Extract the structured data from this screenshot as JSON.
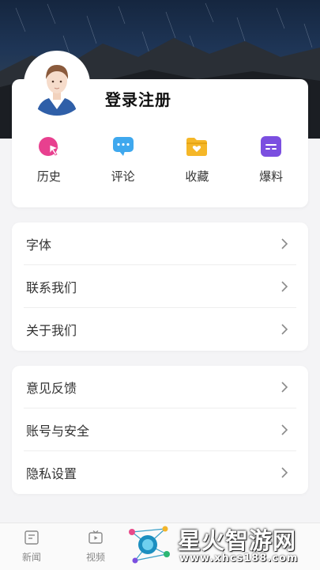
{
  "profile": {
    "login_label": "登录注册"
  },
  "quick_actions": [
    {
      "label": "历史",
      "icon": "history-icon",
      "color": "#e8408f"
    },
    {
      "label": "评论",
      "icon": "comment-icon",
      "color": "#3fa8ee"
    },
    {
      "label": "收藏",
      "icon": "favorite-folder-icon",
      "color": "#f5b728"
    },
    {
      "label": "爆料",
      "icon": "tip-off-icon",
      "color": "#7b4fe0"
    }
  ],
  "settings_group_1": [
    {
      "label": "字体"
    },
    {
      "label": "联系我们"
    },
    {
      "label": "关于我们"
    }
  ],
  "settings_group_2": [
    {
      "label": "意见反馈"
    },
    {
      "label": "账号与安全"
    },
    {
      "label": "隐私设置"
    }
  ],
  "tabbar": {
    "items": [
      {
        "label": "新闻",
        "icon": "news-icon"
      },
      {
        "label": "视频",
        "icon": "video-icon"
      }
    ]
  },
  "watermark": {
    "title": "星火智游网",
    "url": "www.xhcs188.com"
  },
  "colors": {
    "accent_pink": "#e8408f",
    "accent_blue": "#3fa8ee",
    "accent_yellow": "#f5b728",
    "accent_purple": "#7b4fe0"
  }
}
